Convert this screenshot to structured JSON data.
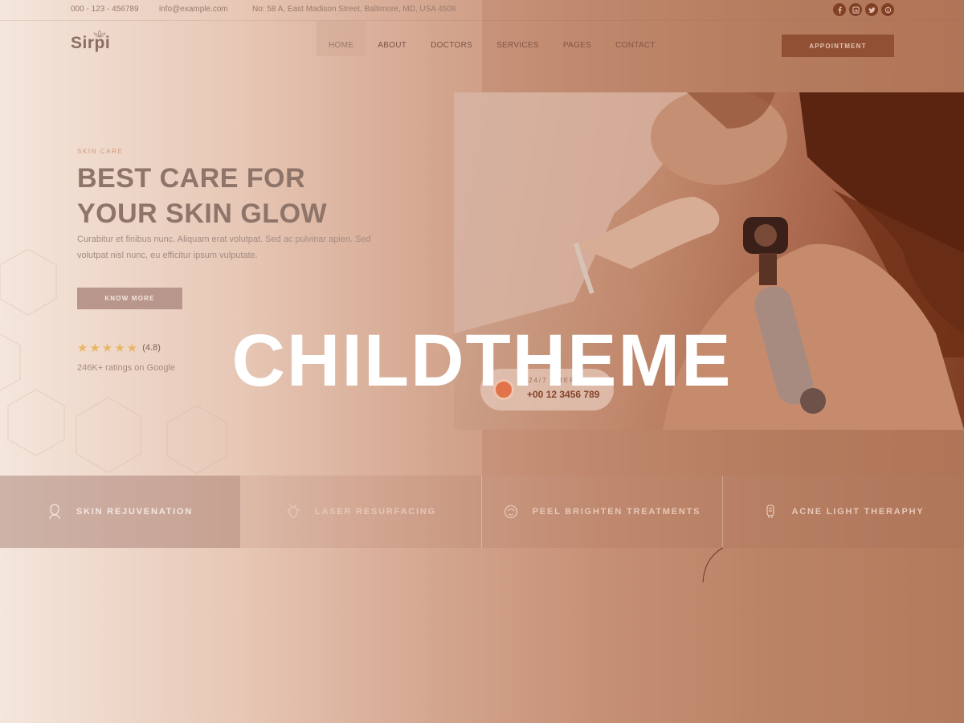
{
  "topbar": {
    "phone": "000 - 123 - 456789",
    "email": "info@example.com",
    "address": "No: 58 A, East Madison Street, Baltimore, MD, USA 4508",
    "socials": [
      "facebook-icon",
      "linkedin-icon",
      "twitter-icon",
      "pinterest-icon"
    ]
  },
  "header": {
    "logo": "Sirpi",
    "nav": [
      "HOME",
      "ABOUT",
      "DOCTORS",
      "SERVICES",
      "PAGES",
      "CONTACT"
    ],
    "active_nav": "HOME",
    "cta": "APPOINTMENT"
  },
  "hero": {
    "eyebrow": "SKIN CARE",
    "title_line1": "BEST CARE FOR",
    "title_line2": "YOUR SKIN GLOW",
    "text": "Curabitur et finibus nunc. Aliquam erat volutpat. Sed ac pulvinar apien. Sed volutpat nisl nunc, eu efficitur ipsum vulputate.",
    "button": "KNOW MORE",
    "stars": "★★★★★",
    "rating_value": "(4.8)",
    "rating_note": "246K+ ratings on Google"
  },
  "emergency": {
    "label": "24/7 EMERGENCY",
    "phone": "+00 12 3456 789"
  },
  "watermark": "CHILDTHEME",
  "services": [
    {
      "label": "SKIN REJUVENATION",
      "icon": "face-icon"
    },
    {
      "label": "LASER RESURFACING",
      "icon": "laser-icon"
    },
    {
      "label": "PEEL BRIGHTEN TREATMENTS",
      "icon": "peel-icon"
    },
    {
      "label": "ACNE LIGHT THERAPHY",
      "icon": "light-device-icon"
    }
  ],
  "colors": {
    "accent": "#8e4d31",
    "star": "#e8b766",
    "title": "#8e7469"
  }
}
